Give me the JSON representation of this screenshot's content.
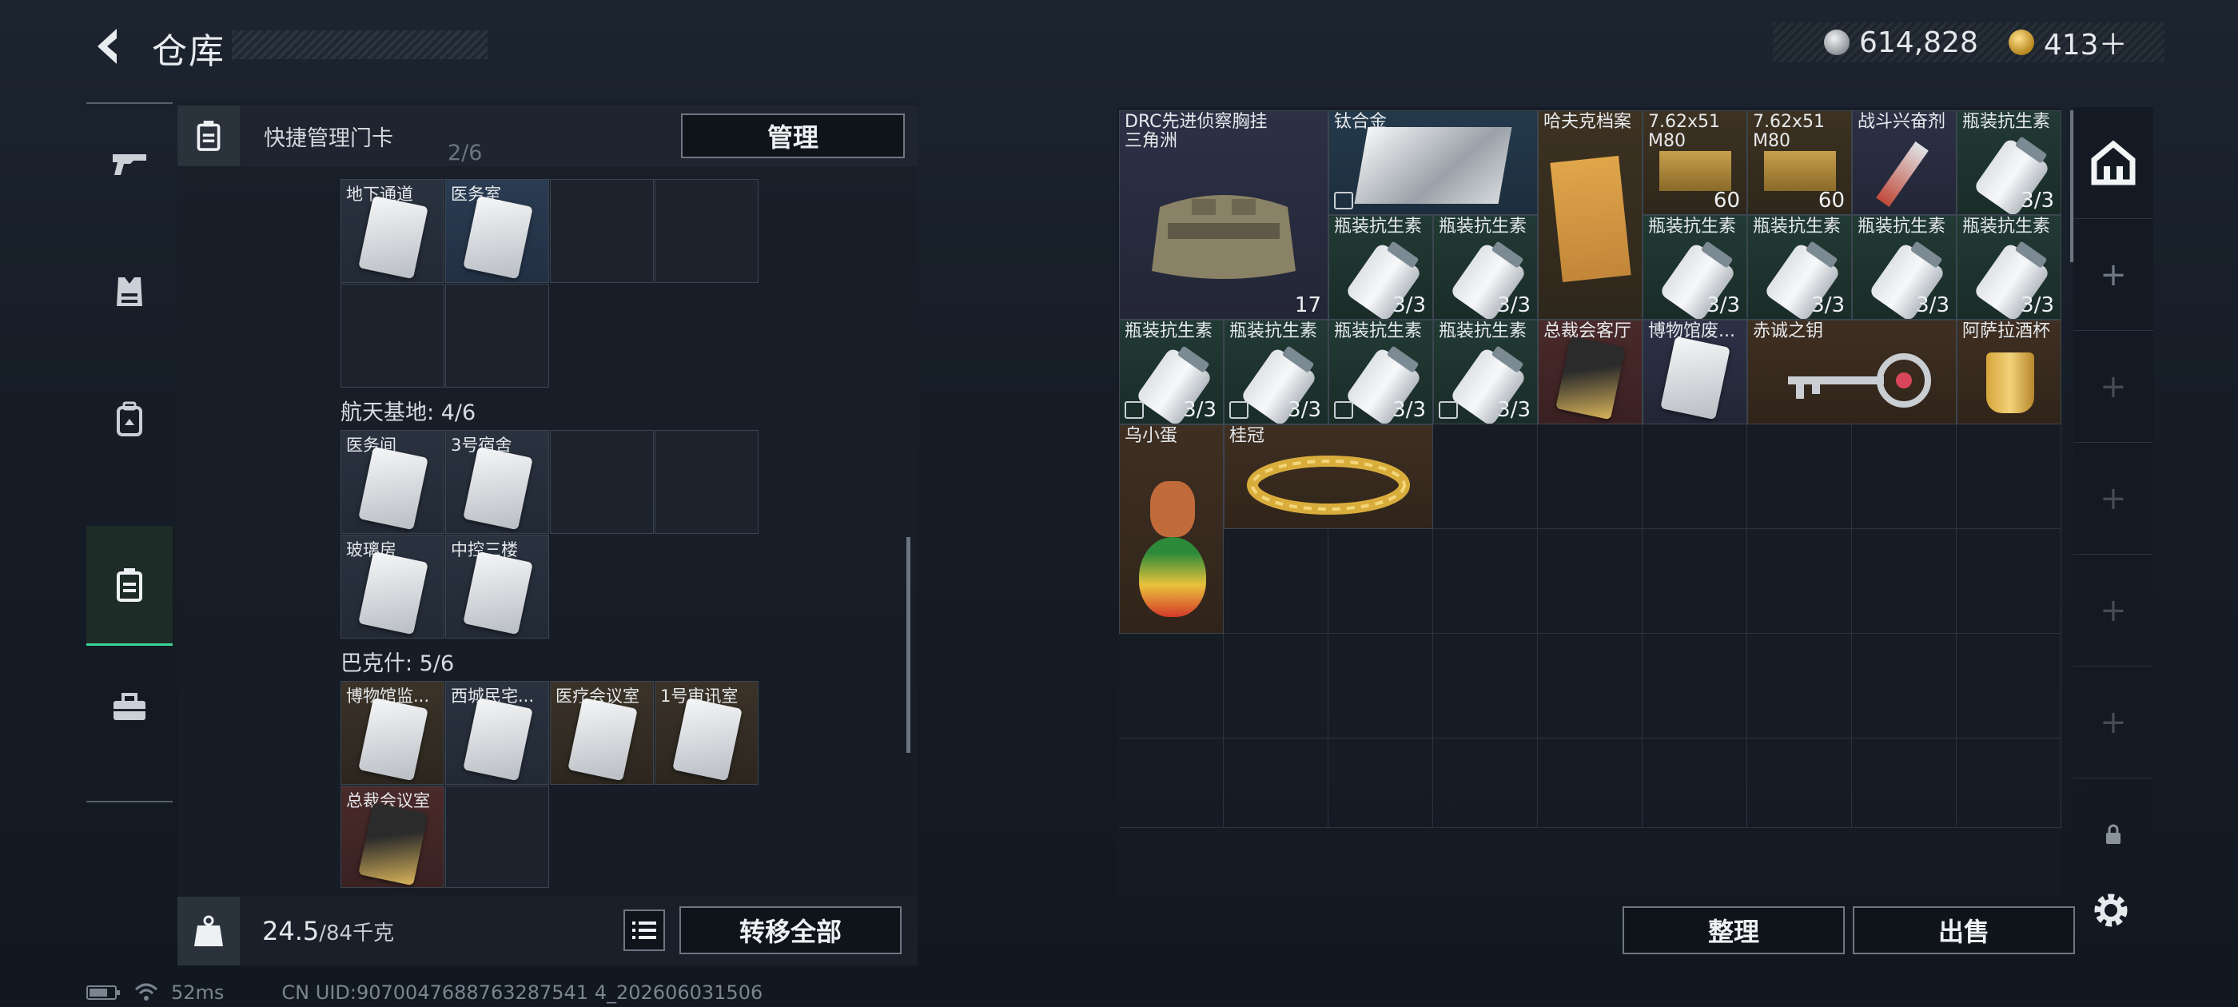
{
  "header": {
    "title": "仓库"
  },
  "currency": {
    "silver": "614,828",
    "gold": "413＋"
  },
  "left_panel": {
    "header_label": "快捷管理门卡",
    "manage_button": "管理",
    "partial_caption": "2/6",
    "slots_top": [
      "地下通道",
      "医务室"
    ],
    "group1_caption": "航天基地: 4/6",
    "group1_slots": [
      "医务间",
      "3号宿舍",
      "玻璃房",
      "中控三楼"
    ],
    "group2_caption": "巴克什: 5/6",
    "group2_slots": [
      "博物馆监...",
      "西城民宅...",
      "医疗会议室",
      "1号审讯室",
      "总裁会议室"
    ],
    "weight": "24.5",
    "weight_max": "/84千克",
    "transfer_all_button": "转移全部"
  },
  "warehouse": {
    "items": {
      "vest": {
        "name": "DRC先进侦察胸挂\n三角洲",
        "count": "17"
      },
      "titanium": {
        "name": "钛合金"
      },
      "file": {
        "name": "哈夫克档案"
      },
      "ammo1": {
        "name": "7.62x51\nM80",
        "count": "60"
      },
      "ammo2": {
        "name": "7.62x51\nM80",
        "count": "60"
      },
      "stim": {
        "name": "战斗兴奋剂"
      },
      "bottle": {
        "name": "瓶装抗生素",
        "count": "3/3"
      },
      "keycard": {
        "name": "总裁会客厅"
      },
      "museum": {
        "name": "博物馆废..."
      },
      "key": {
        "name": "赤诚之钥"
      },
      "cup": {
        "name": "阿萨拉酒杯"
      },
      "egg": {
        "name": "乌小蛋"
      },
      "crown": {
        "name": "桂冠"
      }
    },
    "sort_button": "整理",
    "sell_button": "出售"
  },
  "status_bar": {
    "ping": "52ms",
    "uid": "CN UID:9070047688763287541 4_202606031506"
  }
}
